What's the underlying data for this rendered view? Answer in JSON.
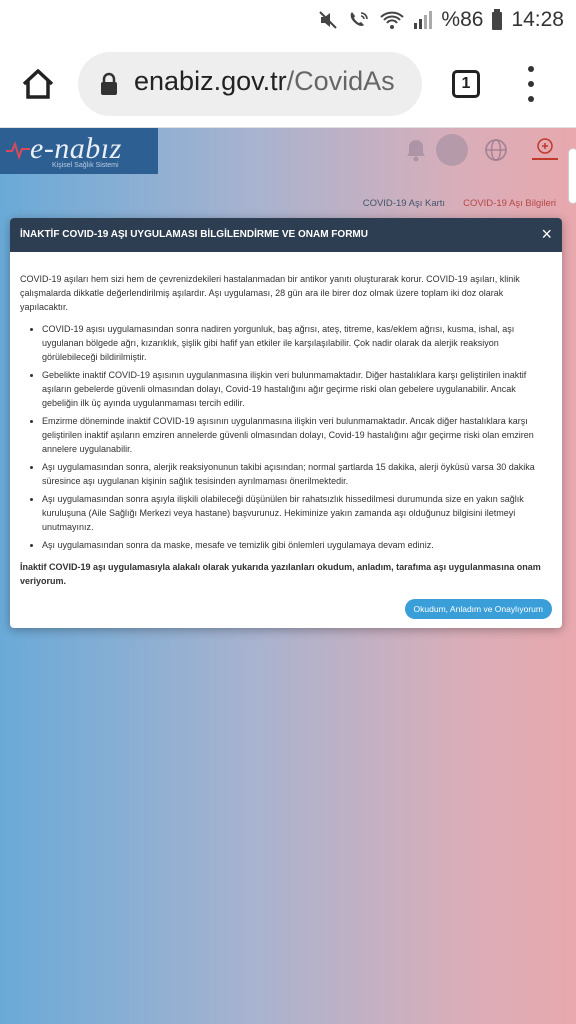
{
  "status_bar": {
    "battery_percent": "%86",
    "time": "14:28",
    "icons": [
      "mute-icon",
      "wifi-call-icon",
      "wifi-icon",
      "signal-icon",
      "battery-icon"
    ]
  },
  "browser": {
    "url_domain": "enabiz.gov.tr",
    "url_path": "/CovidAs",
    "tab_count": "1",
    "icons": [
      "home-icon",
      "lock-icon",
      "tabs-icon",
      "more-menu-icon"
    ]
  },
  "site": {
    "logo_text": "e-nabız",
    "logo_subtitle": "Kişisel Sağlık Sistemi",
    "header_icons": [
      "bell-icon",
      "avatar",
      "globe-icon",
      "ministry-logo"
    ],
    "breadcrumbs": [
      "COVID-19 Aşı Kartı",
      "COVID-19 Aşı Bilgileri"
    ]
  },
  "modal": {
    "title": "İNAKTİF COVID-19 AŞI UYGULAMASI BİLGİLENDİRME VE ONAM FORMU",
    "close_symbol": "×",
    "intro": "COVID-19 aşıları hem sizi hem de çevrenizdekileri hastalanmadan bir antikor yanıtı oluşturarak korur. COVID-19 aşıları, klinik çalışmalarda dikkatle değerlendirilmiş aşılardır. Aşı uygulaması, 28 gün ara ile birer doz olmak üzere toplam iki doz olarak yapılacaktır.",
    "bullets": [
      "COVID-19 aşısı uygulamasından sonra nadiren yorgunluk, baş ağrısı, ateş, titreme, kas/eklem ağrısı, kusma, ishal, aşı uygulanan bölgede ağrı, kızarıklık, şişlik gibi hafif yan etkiler ile karşılaşılabilir. Çok nadir olarak da alerjik reaksiyon görülebileceği bildirilmiştir.",
      "Gebelikte inaktif COVID-19 aşısının uygulanmasına ilişkin veri bulunmamaktadır. Diğer hastalıklara karşı geliştirilen inaktif aşıların gebelerde güvenli olmasından dolayı, Covid-19 hastalığını ağır geçirme riski olan gebelere uygulanabilir. Ancak gebeliğin ilk üç ayında uygulanmaması tercih edilir.",
      "Emzirme döneminde inaktif COVID-19 aşısının uygulanmasına ilişkin veri bulunmamaktadır. Ancak diğer hastalıklara karşı geliştirilen inaktif aşıların emziren annelerde güvenli olmasından dolayı, Covid-19 hastalığını ağır geçirme riski olan emziren annelere uygulanabilir.",
      "Aşı uygulamasından sonra, alerjik reaksiyonunun takibi açısından; normal şartlarda 15 dakika, alerji öyküsü varsa 30 dakika süresince aşı uygulanan kişinin sağlık tesisinden ayrılmaması önerilmektedir.",
      "Aşı uygulamasından sonra aşıyla ilişkili olabileceği düşünülen bir rahatsızlık hissedilmesi durumunda size en yakın sağlık kuruluşuna (Aile Sağlığı Merkezi veya hastane) başvurunuz. Hekiminize yakın zamanda aşı olduğunuz bilgisini iletmeyi unutmayınız.",
      "Aşı uygulamasından sonra da maske, mesafe ve temizlik gibi önlemleri uygulamaya devam ediniz."
    ],
    "consent": "İnaktif COVID-19 aşı uygulamasıyla alakalı olarak yukarıda yazılanları okudum, anladım, tarafıma aşı uygulanmasına onam veriyorum.",
    "confirm_button": "Okudum, Anladım ve Onaylıyorum"
  }
}
